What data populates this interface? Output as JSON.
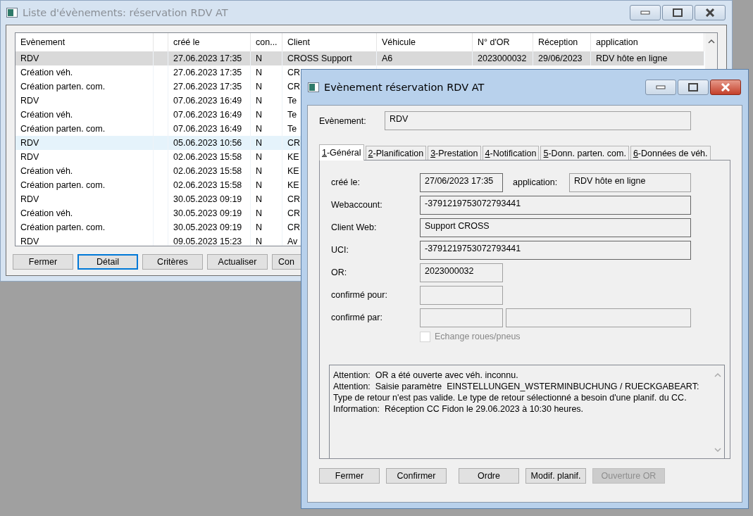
{
  "list_window": {
    "title": "Liste d'évènements: réservation RDV AT",
    "columns": [
      "Evènement",
      "",
      "créé le",
      "con...",
      "Client",
      "Véhicule",
      "N° d'OR",
      "Réception",
      "application"
    ],
    "rows": [
      {
        "cells": [
          "RDV",
          "",
          "27.06.2023 17:35",
          "N",
          "CROSS Support",
          "A6",
          "2023000032",
          "29/06/2023",
          "RDV hôte en ligne"
        ],
        "selected": true,
        "hovered": false
      },
      {
        "cells": [
          "Création véh.",
          "",
          "27.06.2023 17:35",
          "N",
          "CR"
        ],
        "selected": false,
        "hovered": false
      },
      {
        "cells": [
          "Création parten. com.",
          "",
          "27.06.2023 17:35",
          "N",
          "CR"
        ],
        "selected": false,
        "hovered": false
      },
      {
        "cells": [
          "RDV",
          "",
          "07.06.2023 16:49",
          "N",
          "Te"
        ],
        "selected": false,
        "hovered": false
      },
      {
        "cells": [
          "Création véh.",
          "",
          "07.06.2023 16:49",
          "N",
          "Te"
        ],
        "selected": false,
        "hovered": false
      },
      {
        "cells": [
          "Création parten. com.",
          "",
          "07.06.2023 16:49",
          "N",
          "Te"
        ],
        "selected": false,
        "hovered": false
      },
      {
        "cells": [
          "RDV",
          "",
          "05.06.2023 10:56",
          "N",
          "CR"
        ],
        "selected": false,
        "hovered": true
      },
      {
        "cells": [
          "RDV",
          "",
          "02.06.2023 15:58",
          "N",
          "KE"
        ],
        "selected": false,
        "hovered": false
      },
      {
        "cells": [
          "Création véh.",
          "",
          "02.06.2023 15:58",
          "N",
          "KE"
        ],
        "selected": false,
        "hovered": false
      },
      {
        "cells": [
          "Création parten. com.",
          "",
          "02.06.2023 15:58",
          "N",
          "KE"
        ],
        "selected": false,
        "hovered": false
      },
      {
        "cells": [
          "RDV",
          "",
          "30.05.2023 09:19",
          "N",
          "CR"
        ],
        "selected": false,
        "hovered": false
      },
      {
        "cells": [
          "Création véh.",
          "",
          "30.05.2023 09:19",
          "N",
          "CR"
        ],
        "selected": false,
        "hovered": false
      },
      {
        "cells": [
          "Création parten. com.",
          "",
          "30.05.2023 09:19",
          "N",
          "CR"
        ],
        "selected": false,
        "hovered": false
      },
      {
        "cells": [
          "RDV",
          "",
          "09.05.2023 15:23",
          "N",
          "Av"
        ],
        "selected": false,
        "hovered": false
      }
    ],
    "buttons": [
      {
        "label": "Fermer",
        "focused": false
      },
      {
        "label": "Détail",
        "focused": true
      },
      {
        "label": "Critères",
        "focused": false
      },
      {
        "label": "Actualiser",
        "focused": false
      },
      {
        "label": "Con",
        "focused": false
      }
    ]
  },
  "dialog": {
    "title": "Evènement réservation RDV AT",
    "event": {
      "label": "Evènement:",
      "value": "RDV"
    },
    "tabs": [
      {
        "label": "1-Général",
        "selected": true
      },
      {
        "label": "2-Planification",
        "selected": false
      },
      {
        "label": "3-Prestation",
        "selected": false
      },
      {
        "label": "4-Notification",
        "selected": false
      },
      {
        "label": "5-Donn. parten. com.",
        "selected": false
      },
      {
        "label": "6-Données de véh.",
        "selected": false
      }
    ],
    "form": [
      {
        "kind": "short_side",
        "label": "créé le:",
        "value": "27/06/2023 17:35",
        "side_label": "application:",
        "side_value": "RDV hôte en ligne"
      },
      {
        "kind": "wide",
        "label": "Webaccount:",
        "value": "-3791219753072793441"
      },
      {
        "kind": "wide",
        "label": "Client Web:",
        "value": "Support CROSS"
      },
      {
        "kind": "wide",
        "label": "UCI:",
        "value": "-3791219753072793441"
      },
      {
        "kind": "short",
        "label": "OR:",
        "value": "2023000032"
      },
      {
        "kind": "short",
        "label": "confirmé pour:"
      },
      {
        "kind": "pair",
        "label": "confirmé par:"
      }
    ],
    "checkbox": {
      "label": "Echange roues/pneus",
      "checked": false,
      "disabled": true
    },
    "messages": [
      "Attention:  OR a été ouverte avec véh. inconnu.",
      "Attention:  Saisie paramètre  EINSTELLUNGEN_WSTERMINBUCHUNG / RUECKGABEART:",
      "Type de retour n'est pas valide. Le type de retour sélectionné a besoin d'une planif. du CC.",
      "Information:  Réception CC Fidon le 29.06.2023 à 10:30 heures."
    ],
    "buttons": [
      {
        "label": "Fermer",
        "disabled": false
      },
      {
        "label": "Confirmer",
        "disabled": false
      },
      {
        "label": "Ordre",
        "disabled": false
      },
      {
        "label": "Modif. planif.",
        "disabled": false
      },
      {
        "label": "Ouverture OR",
        "disabled": true
      }
    ]
  }
}
